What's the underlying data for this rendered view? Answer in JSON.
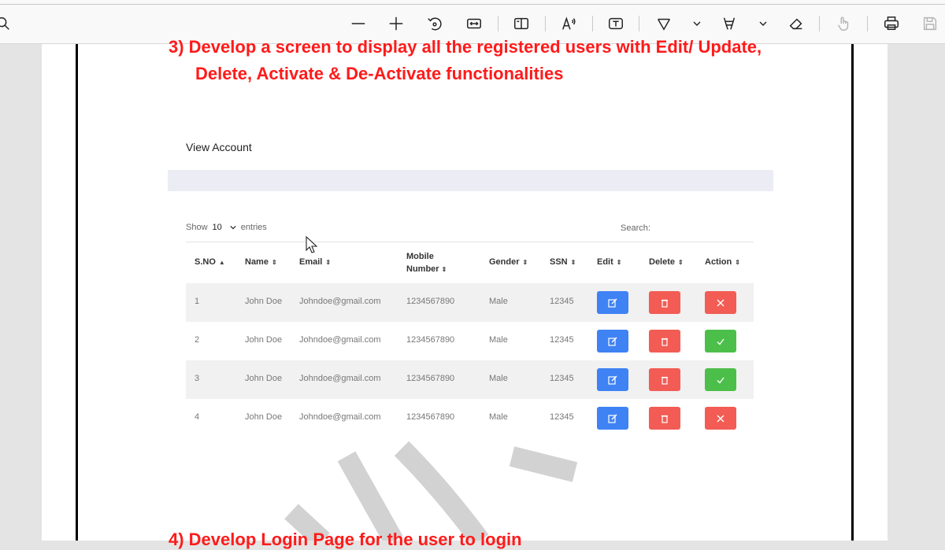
{
  "toolbar": {
    "icons": [
      "search-icon",
      "zoom-out-icon",
      "zoom-in-icon",
      "rotate-icon",
      "fit-width-icon",
      "page-view-icon",
      "read-aloud-icon",
      "text-box-icon",
      "draw-icon",
      "highlight-icon",
      "eraser-icon",
      "touch-icon",
      "print-icon",
      "save-icon"
    ]
  },
  "document": {
    "heading_3_line1": "3) Develop a screen to display all the registered users with Edit/ Update,",
    "heading_3_line2": "Delete, Activate & De-Activate functionalities",
    "heading_4": "4) Develop Login Page for the user to login"
  },
  "screenshot_ui": {
    "card_title": "View Account",
    "show_label": "Show",
    "entries_value": "10",
    "entries_label": "entries",
    "search_label": "Search:",
    "columns": [
      "S.NO",
      "Name",
      "Email",
      "Mobile",
      "Number",
      "Gender",
      "SSN",
      "Edit",
      "Delete",
      "Action"
    ],
    "rows": [
      {
        "sno": "1",
        "name": "John Doe",
        "email": "Johndoe@gmail.com",
        "mobile": "1234567890",
        "gender": "Male",
        "ssn": "12345",
        "action": "deactivate"
      },
      {
        "sno": "2",
        "name": "John Doe",
        "email": "Johndoe@gmail.com",
        "mobile": "1234567890",
        "gender": "Male",
        "ssn": "12345",
        "action": "activate"
      },
      {
        "sno": "3",
        "name": "John Doe",
        "email": "Johndoe@gmail.com",
        "mobile": "1234567890",
        "gender": "Male",
        "ssn": "12345",
        "action": "activate"
      },
      {
        "sno": "4",
        "name": "John Doe",
        "email": "Johndoe@gmail.com",
        "mobile": "1234567890",
        "gender": "Male",
        "ssn": "12345",
        "action": "deactivate"
      }
    ]
  },
  "colors": {
    "heading_red": "#ff1a1a",
    "edit_blue": "#3f82f4",
    "delete_red": "#f25c54",
    "activate_green": "#4cbf4a"
  }
}
